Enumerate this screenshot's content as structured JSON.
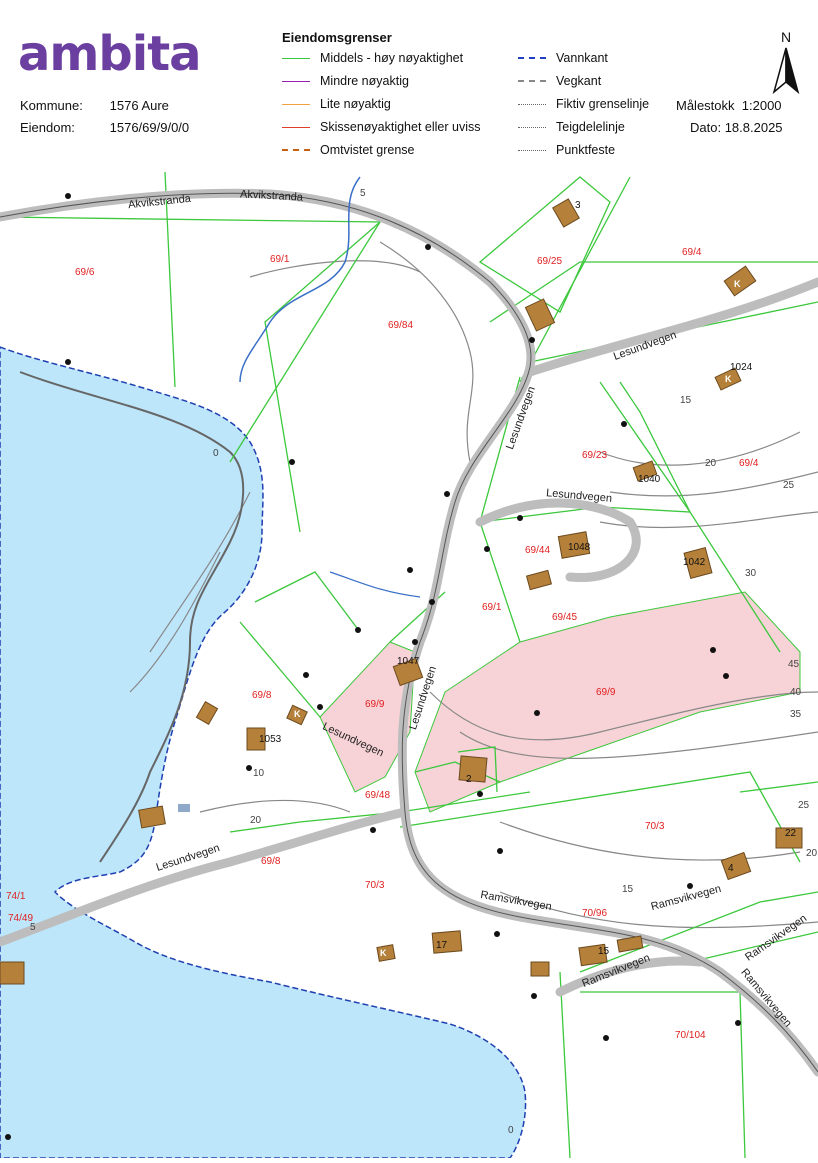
{
  "logo": {
    "text": "ambita"
  },
  "property": {
    "kommune_label": "Kommune:",
    "kommune_value": "1576 Aure",
    "eiendom_label": "Eiendom:",
    "eiendom_value": "1576/69/9/0/0"
  },
  "legend": {
    "title": "Eiendomsgrenser",
    "items": [
      {
        "label": "Middels - høy nøyaktighet",
        "color": "#3cc83c",
        "style": "solid"
      },
      {
        "label": "Mindre nøyaktig",
        "color": "#9b1fb0",
        "style": "solid"
      },
      {
        "label": "Lite nøyaktig",
        "color": "#f0a040",
        "style": "solid"
      },
      {
        "label": "Skissenøyaktighet eller uviss",
        "color": "#e03c2c",
        "style": "solid"
      },
      {
        "label": "Omtvistet grense",
        "color": "#c86014",
        "style": "dashed"
      },
      {
        "label": "Vannkant",
        "color": "#2040c0",
        "style": "dashed"
      },
      {
        "label": "Vegkant",
        "color": "#888888",
        "style": "dashed"
      },
      {
        "label": "Fiktiv grenselinje",
        "color": "#666666",
        "style": "dotted"
      },
      {
        "label": "Teigdelelinje",
        "color": "#666666",
        "style": "dotted"
      },
      {
        "label": "Punktfeste",
        "color": "#666666",
        "style": "dotted"
      }
    ]
  },
  "scale": {
    "label": "Målestokk",
    "value": "1:2000"
  },
  "date": {
    "label": "Dato:",
    "value": "18.8.2025"
  },
  "north": {
    "label": "N"
  },
  "map": {
    "parcels": [
      "69/6",
      "69/1",
      "69/84",
      "69/25",
      "69/4",
      "69/23",
      "69/4",
      "69/44",
      "69/1",
      "69/45",
      "69/9",
      "69/8",
      "69/9",
      "69/48",
      "70/3",
      "69/8",
      "70/3",
      "70/96",
      "70/104",
      "74/1",
      "74/49"
    ],
    "roads": [
      "Akvikstranda",
      "Akvikstranda",
      "Lesundvegen",
      "Lesundvegen",
      "Lesundvegen",
      "Lesundvegen",
      "Lesundvegen",
      "Lesundvegen",
      "Ramsvikvegen",
      "Ramsvikvegen",
      "Ramsvikvegen",
      "Ramsvikvegen",
      "Ramsvikvegen"
    ],
    "house_numbers": [
      "3",
      "1024",
      "1040",
      "1048",
      "1042",
      "1047",
      "1053",
      "2",
      "22",
      "4",
      "17",
      "15"
    ],
    "building_marks": [
      "K",
      "K",
      "K",
      "K"
    ],
    "contours": [
      "5",
      "15",
      "20",
      "25",
      "30",
      "45",
      "40",
      "35",
      "0",
      "10",
      "20",
      "25",
      "20",
      "15",
      "0",
      "5"
    ]
  }
}
